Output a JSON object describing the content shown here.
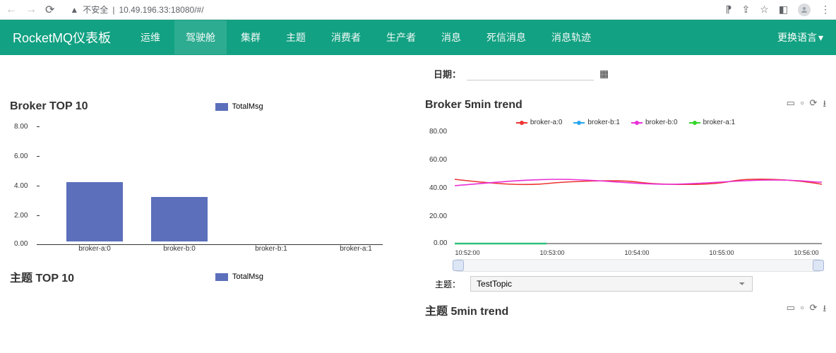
{
  "browser": {
    "security_label": "不安全",
    "url": "10.49.196.33:18080/#/"
  },
  "nav": {
    "brand": "RocketMQ仪表板",
    "items": [
      "运维",
      "驾驶舱",
      "集群",
      "主题",
      "消费者",
      "生产者",
      "消息",
      "死信消息",
      "消息轨迹"
    ],
    "active_index": 1,
    "language": "更换语言"
  },
  "date": {
    "label": "日期："
  },
  "broker_top10": {
    "title": "Broker TOP 10",
    "legend": "TotalMsg"
  },
  "broker_trend": {
    "title": "Broker 5min trend"
  },
  "topic_top10": {
    "title": "主题 TOP 10",
    "legend": "TotalMsg"
  },
  "topic_trend": {
    "title": "主题 5min trend"
  },
  "topic_select": {
    "label": "主题：",
    "value": "TestTopic"
  },
  "chart_data": [
    {
      "id": "broker_top10",
      "type": "bar",
      "title": "Broker TOP 10",
      "categories": [
        "broker-a:0",
        "broker-b:0",
        "broker-b:1",
        "broker-a:1"
      ],
      "values": [
        4.0,
        3.0,
        0.0,
        0.0
      ],
      "ylabel": "",
      "xlabel": "",
      "ylim": [
        0,
        8
      ],
      "yticks": [
        0.0,
        2.0,
        4.0,
        6.0,
        8.0
      ],
      "series_name": "TotalMsg"
    },
    {
      "id": "broker_5min_trend",
      "type": "line",
      "title": "Broker 5min trend",
      "x": [
        "10:52:00",
        "10:53:00",
        "10:54:00",
        "10:55:00",
        "10:56:00"
      ],
      "series": [
        {
          "name": "broker-a:0",
          "color": "#ed3333",
          "values": [
            44,
            40,
            42,
            40,
            43,
            40
          ]
        },
        {
          "name": "broker-b:1",
          "color": "#29a6ed",
          "values": [
            0,
            0,
            0,
            0,
            0,
            0
          ]
        },
        {
          "name": "broker-b:0",
          "color": "#e930d6",
          "values": [
            40,
            42,
            44,
            41,
            43,
            42
          ]
        },
        {
          "name": "broker-a:1",
          "color": "#34d62a",
          "values": [
            0,
            0,
            0,
            0,
            0,
            0
          ]
        }
      ],
      "ylim": [
        0,
        80
      ],
      "yticks": [
        0.0,
        20.0,
        40.0,
        60.0,
        80.0
      ],
      "xlabel": "",
      "ylabel": ""
    }
  ]
}
